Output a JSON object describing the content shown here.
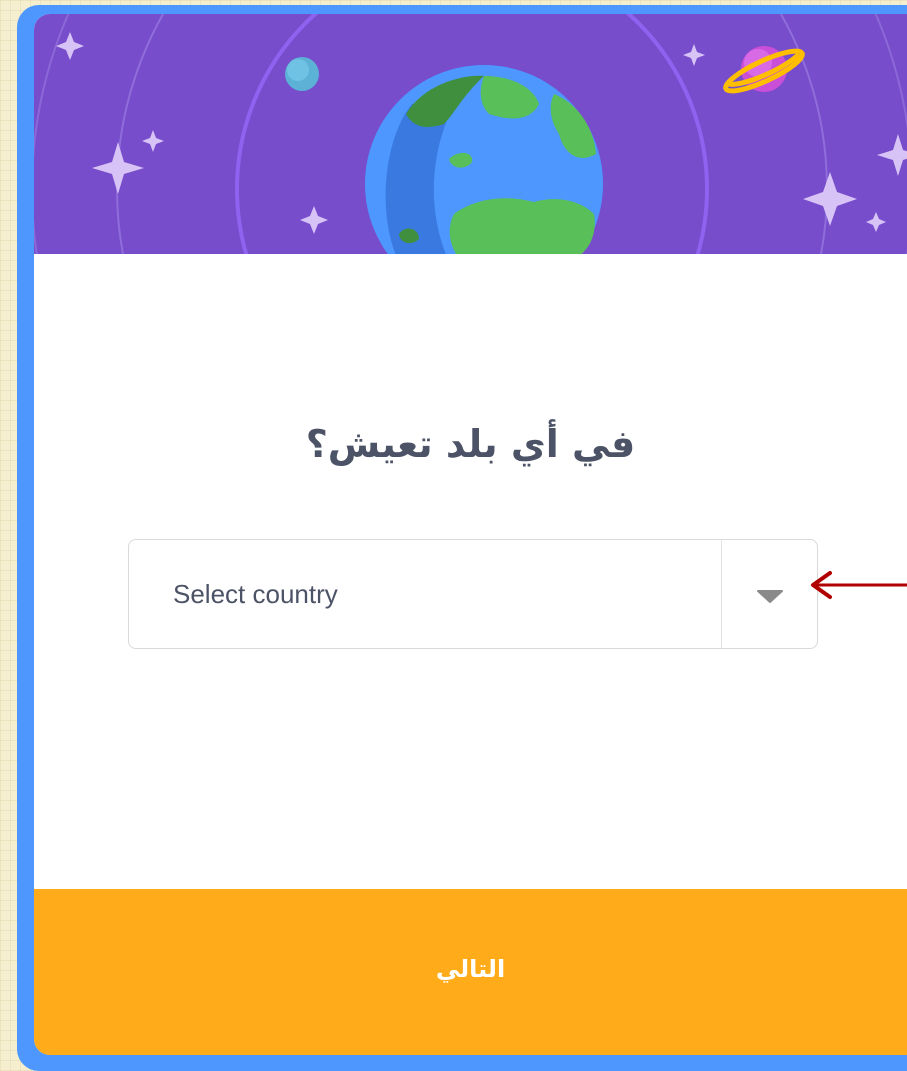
{
  "dialog": {
    "question": "في أي بلد تعيش؟",
    "country_select": {
      "placeholder": "Select country",
      "icon": "chevron-down-icon"
    },
    "next_button_label": "التالي"
  },
  "colors": {
    "banner": "#774dcb",
    "frame": "#4d97ff",
    "next_button": "#ffab1a",
    "annotation_arrow": "#b00000",
    "text": "#4c5366"
  },
  "banner_icons": [
    "earth-icon",
    "planet-icon",
    "moon-icon",
    "sparkle-icon"
  ]
}
